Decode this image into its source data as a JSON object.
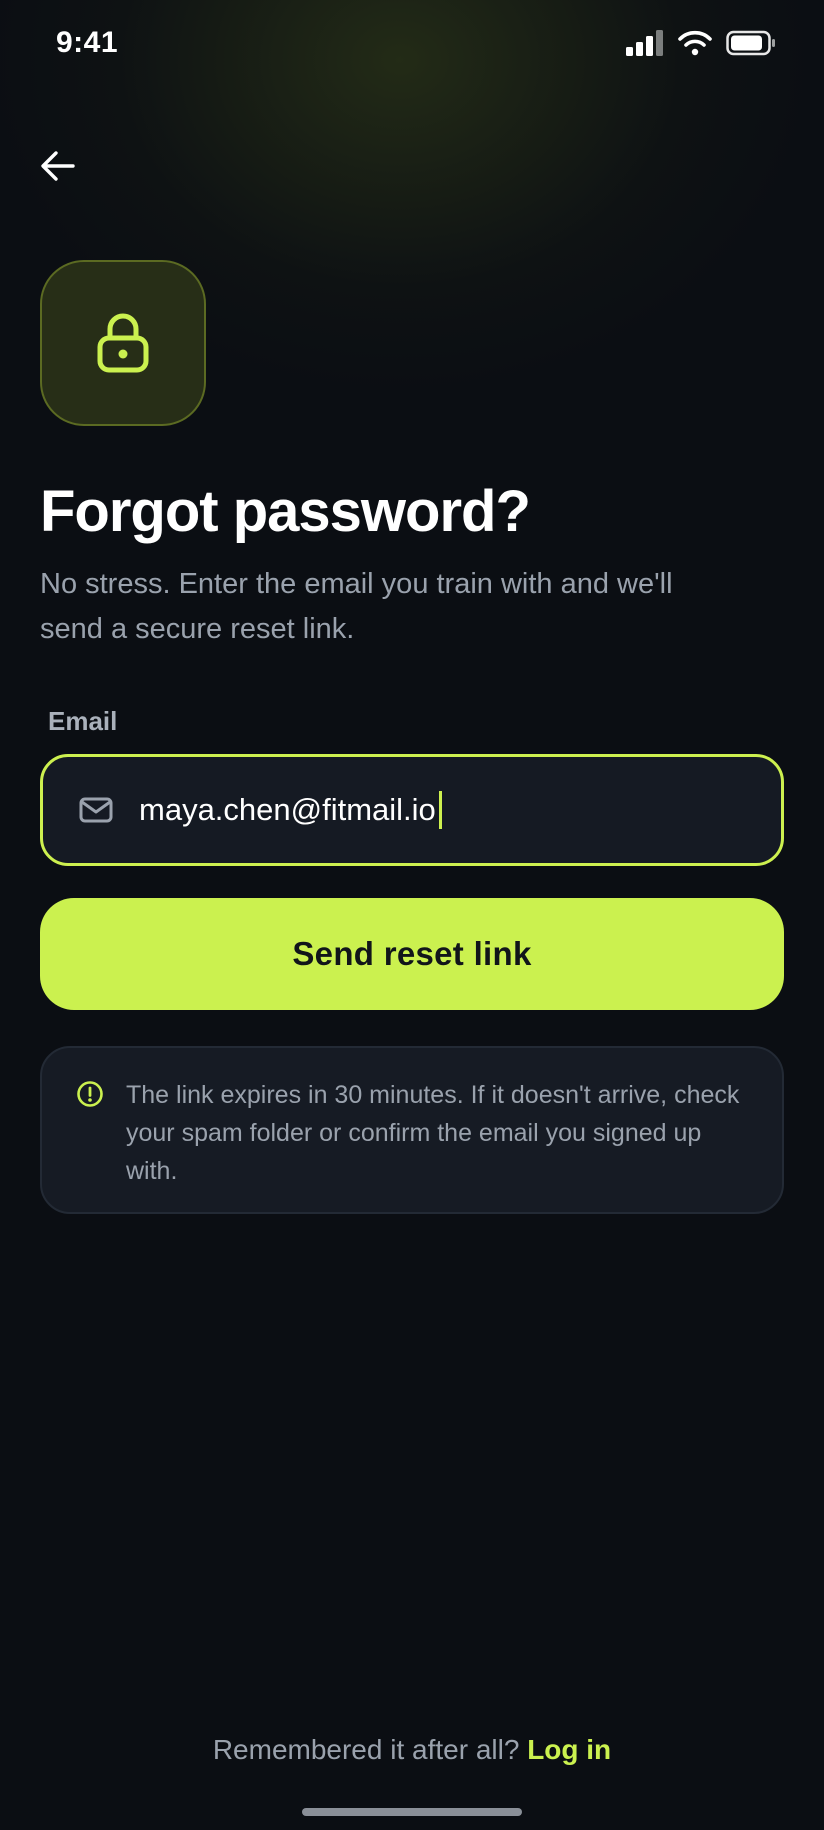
{
  "status_bar": {
    "time": "9:41",
    "icons": [
      "signal-icon",
      "wifi-icon",
      "battery-icon"
    ]
  },
  "header": {
    "back_icon": "arrow-left-icon"
  },
  "hero": {
    "badge_icon": "lock-icon",
    "title": "Forgot password?",
    "subtitle": "No stress. Enter the email you train with and we'll send a secure reset link."
  },
  "form": {
    "email_label": "Email",
    "email_icon": "mail-icon",
    "email_value": "maya.chen@fitmail.io",
    "submit_label": "Send reset link"
  },
  "info": {
    "icon": "alert-circle-icon",
    "text": "The link expires in 30 minutes. If it doesn't arrive, check your spam folder or confirm the email you signed up with."
  },
  "footer": {
    "prompt": "Remembered it after all?",
    "link_label": "Log in"
  },
  "colors": {
    "background": "#0b0e13",
    "accent": "#cbf14f",
    "muted_text": "#9aa2ad",
    "card": "#161b24"
  }
}
